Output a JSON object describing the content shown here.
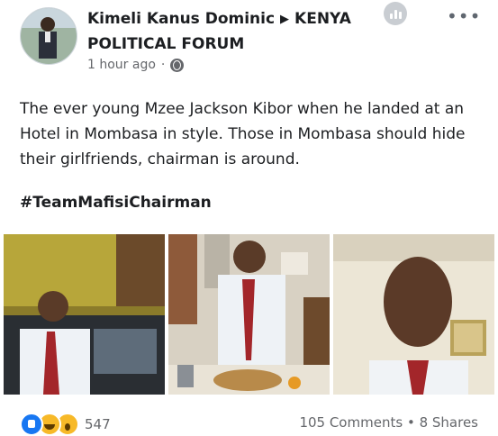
{
  "post": {
    "author": "Kimeli Kanus Dominic",
    "group": "KENYA POLITICAL FORUM",
    "timestamp": "1 hour ago",
    "separator": "·",
    "body": "The ever young Mzee Jackson Kibor when he landed at an Hotel in Mombasa in style. Those in Mombasa should hide their girlfriends, chairman is around.",
    "hashtag": "#TeamMafisiChairman",
    "icons": {
      "privacy": "globe-icon",
      "insights": "insights-icon",
      "more": "more-options-icon"
    }
  },
  "reactions": {
    "types": [
      "like",
      "haha",
      "wow"
    ],
    "count": "547"
  },
  "stats": {
    "comments": "105 Comments",
    "separator": "•",
    "shares": "8 Shares"
  },
  "colors": {
    "like": "#1877f2",
    "meta": "#65676b",
    "text": "#1c1e21"
  }
}
